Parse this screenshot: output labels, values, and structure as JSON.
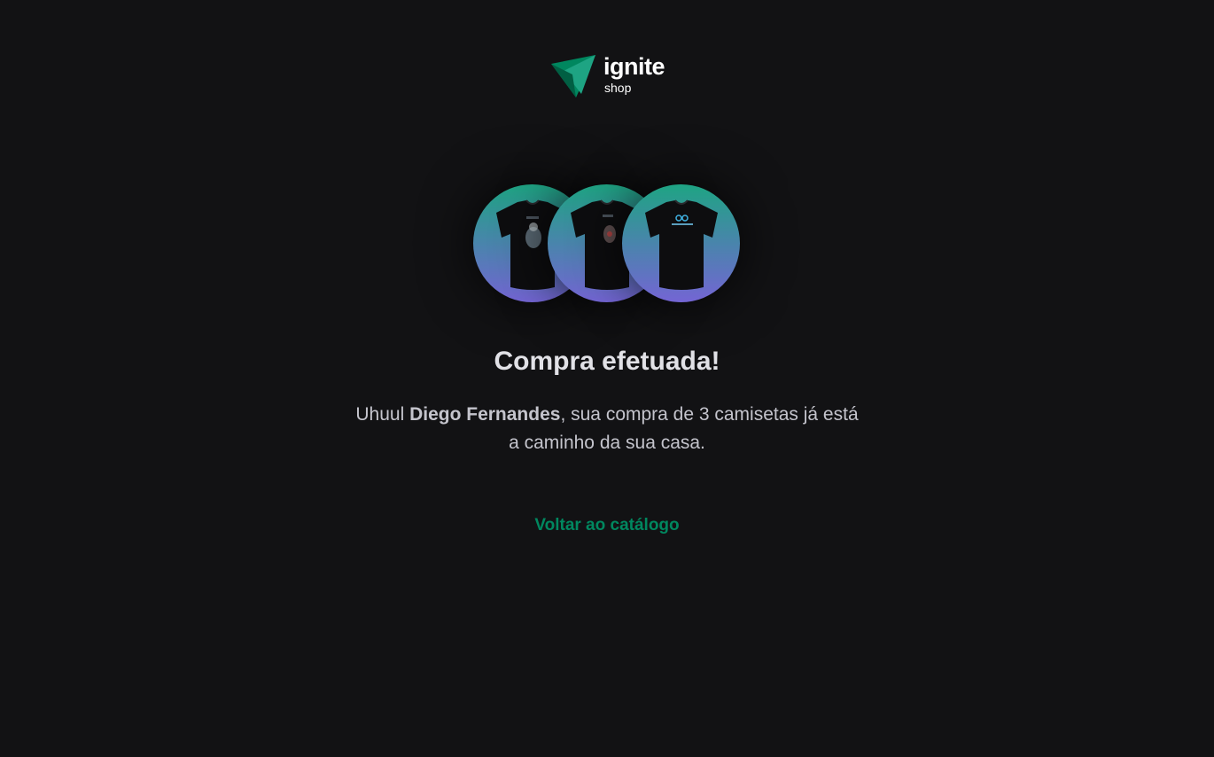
{
  "brand": {
    "name": "ignite",
    "sub": "shop",
    "colors": {
      "logo_light": "#1ea483",
      "logo_dark": "#00875f",
      "logo_mid": "#015f43"
    }
  },
  "thumbnails": [
    {
      "icon": "tshirt-astronaut-icon"
    },
    {
      "icon": "tshirt-astronaut-red-icon"
    },
    {
      "icon": "tshirt-logo-icon"
    }
  ],
  "success": {
    "title": "Compra efetuada!",
    "message_prefix": "Uhuul ",
    "customer_name": "Diego Fernandes",
    "message_suffix": ", sua compra de 3 camisetas já está a caminho da sua casa.",
    "back_label": "Voltar ao catálogo"
  },
  "colors": {
    "background": "#121214",
    "title": "#e1e1e6",
    "text": "#c4c4cc",
    "accent": "#00875f",
    "gradient_top": "#1ea483",
    "gradient_bottom": "#7465d4"
  }
}
